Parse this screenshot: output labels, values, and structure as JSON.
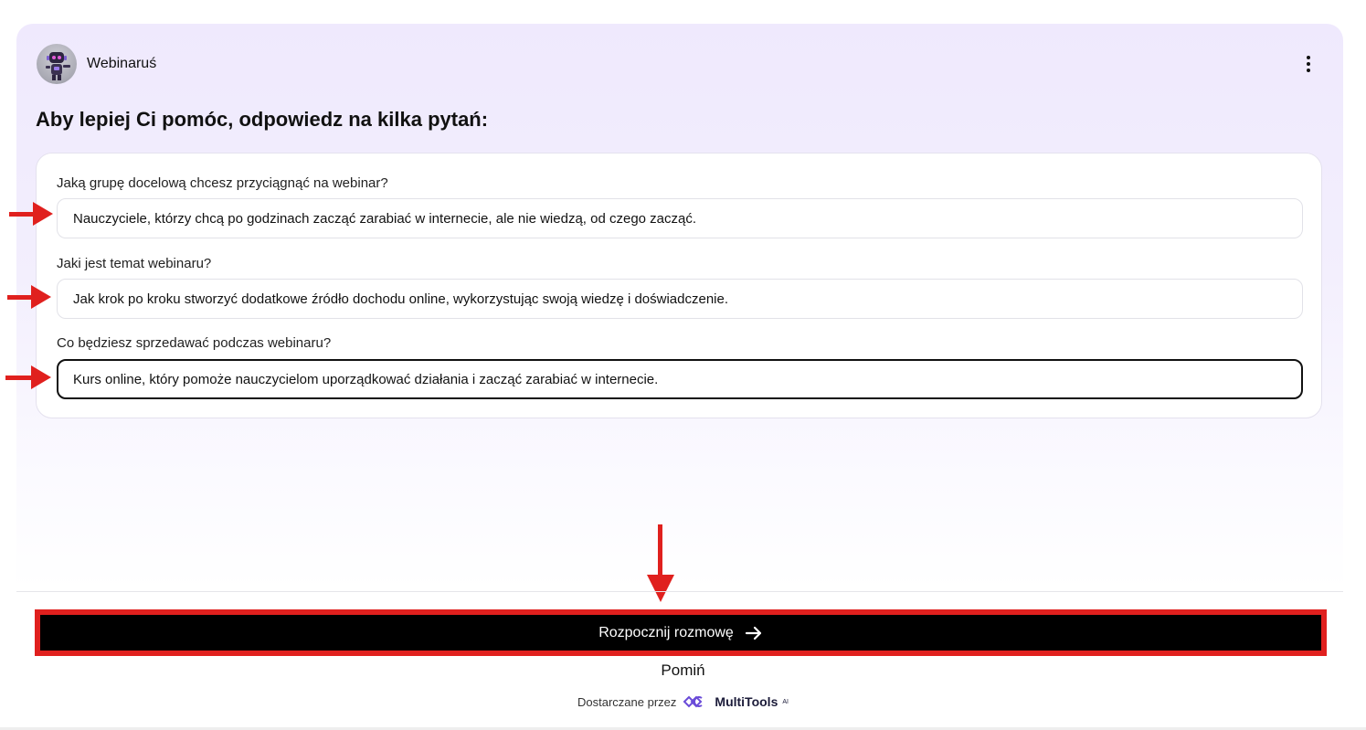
{
  "bot": {
    "name": "Webinaruś"
  },
  "heading": "Aby lepiej Ci pomóc, odpowiedz na kilka pytań:",
  "questions": [
    {
      "label": "Jaką grupę docelową chcesz przyciągnąć na webinar?",
      "value": "Nauczyciele, którzy chcą po godzinach zacząć zarabiać w internecie, ale nie wiedzą, od czego zacząć."
    },
    {
      "label": "Jaki jest temat webinaru?",
      "value": "Jak krok po kroku stworzyć dodatkowe źródło dochodu online, wykorzystując swoją wiedzę i doświadczenie."
    },
    {
      "label": "Co będziesz sprzedawać podczas webinaru?",
      "value": "Kurs online, który pomoże nauczycielom uporządkować działania i zacząć zarabiać w internecie."
    }
  ],
  "actions": {
    "start_label": "Rozpocznij rozmowę",
    "skip_label": "Pomiń"
  },
  "footer": {
    "powered_by": "Dostarczane przez",
    "brand_name": "MultiTools",
    "brand_sup": "AI"
  },
  "colors": {
    "accent_annotation": "#e0201e",
    "button_bg": "#000000",
    "panel_bg": "#efe9fd",
    "logo_primary": "#6a4bd8"
  },
  "icons": {
    "menu": "kebab-menu-icon",
    "start_arrow": "arrow-right-icon",
    "avatar": "robot-avatar",
    "brand_logo": "multitools-logo-icon"
  }
}
